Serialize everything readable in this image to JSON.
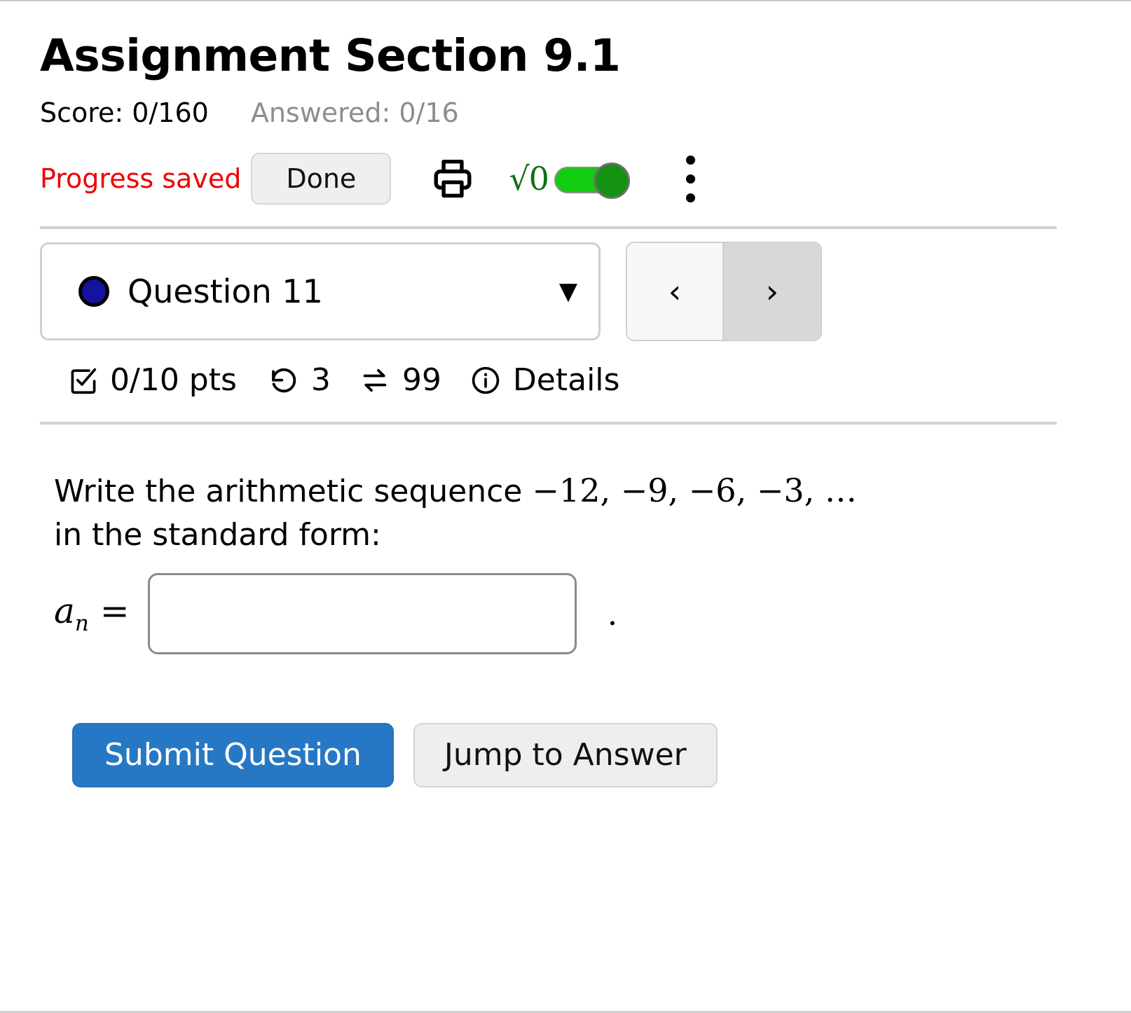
{
  "header": {
    "title": "Assignment Section 9.1",
    "score": "Score: 0/160",
    "answered": "Answered: 0/16"
  },
  "toolbar": {
    "progress_status": "Progress saved",
    "done_label": "Done",
    "print_icon": "printer-icon",
    "math_icon": "square-root-icon",
    "math_glyph": "√0",
    "math_toggle_state": "on",
    "menu_icon": "kebab-menu-icon",
    "colors": {
      "progress_status": "#ee0000",
      "toggle_track": "#11cc11",
      "toggle_knob": "#149214",
      "math_glyph": "#137013"
    }
  },
  "question_nav": {
    "selected_question": "Question 11",
    "status_dot_color": "#13139b",
    "dropdown_caret": "▼",
    "prev_label": "‹",
    "next_label": "›"
  },
  "stats": {
    "points": "0/10 pts",
    "points_icon": "checkbox-checked-icon",
    "attempts": "3",
    "attempts_icon": "undo-rotate-icon",
    "versions": "99",
    "versions_icon": "swap-arrows-icon",
    "details_label": "Details",
    "details_icon": "info-circle-icon"
  },
  "question": {
    "prompt_lead": "Write the arithmetic sequence",
    "sequence": "−12, −9, −6, −3, …",
    "prompt_tail": "in the standard form:",
    "answer_label_base": "a",
    "answer_label_sub": "n",
    "answer_label_eq": "=",
    "answer_value": "",
    "answer_placeholder": "",
    "trailing_punctuation": "."
  },
  "actions": {
    "submit_label": "Submit Question",
    "jump_label": "Jump to Answer",
    "submit_color": "#2778c4"
  }
}
